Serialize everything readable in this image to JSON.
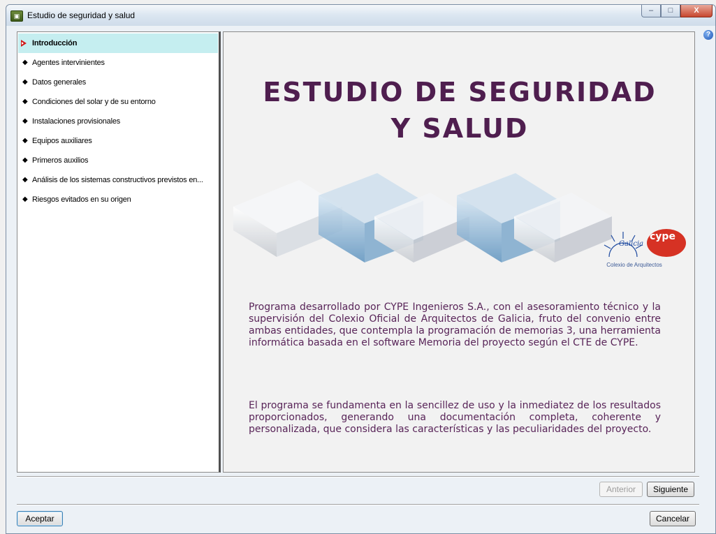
{
  "window": {
    "title": "Estudio de seguridad y salud",
    "controls": {
      "minimize": "–",
      "maximize": "□",
      "close": "X"
    }
  },
  "help": {
    "icon": "help-icon",
    "symbol": "?"
  },
  "sidebar": {
    "items": [
      {
        "label": "Introducción",
        "active": true
      },
      {
        "label": "Agentes intervinientes",
        "active": false
      },
      {
        "label": "Datos generales",
        "active": false
      },
      {
        "label": "Condiciones del solar y de su entorno",
        "active": false
      },
      {
        "label": "Instalaciones provisionales",
        "active": false
      },
      {
        "label": "Equipos auxiliares",
        "active": false
      },
      {
        "label": "Primeros auxilios",
        "active": false
      },
      {
        "label": "Análisis de los sistemas constructivos previstos en...",
        "active": false
      },
      {
        "label": "Riesgos evitados en su origen",
        "active": false
      }
    ]
  },
  "content": {
    "title_line1": "ESTUDIO DE SEGURIDAD",
    "title_line2": "Y SALUD",
    "paragraph1": "Programa desarrollado por CYPE Ingenieros S.A., con el asesoramiento técnico y la supervisión del Colexio Oficial de Arquitectos de Galicia, fruto del convenio entre ambas entidades, que contempla la programación de memorias 3, una herramienta informática basada en el software Memoria del proyecto según el CTE de CYPE.",
    "paragraph2": "El programa se fundamenta en la sencillez de uso y la inmediatez de los resultados proporcionados, generando una documentación completa, coherente y personalizada, que considera las características y las peculiaridades del proyecto.",
    "logo": {
      "cype": "cype",
      "galicia": "Galicia",
      "caption": "Colexio de Arquitectos"
    }
  },
  "navigation": {
    "previous": "Anterior",
    "next": "Siguiente"
  },
  "footer": {
    "accept": "Aceptar",
    "cancel": "Cancelar"
  },
  "colors": {
    "accent_title": "#4f1e4f",
    "text": "#582458",
    "active_item": "#c5eef0",
    "cype_red": "#d63224"
  }
}
